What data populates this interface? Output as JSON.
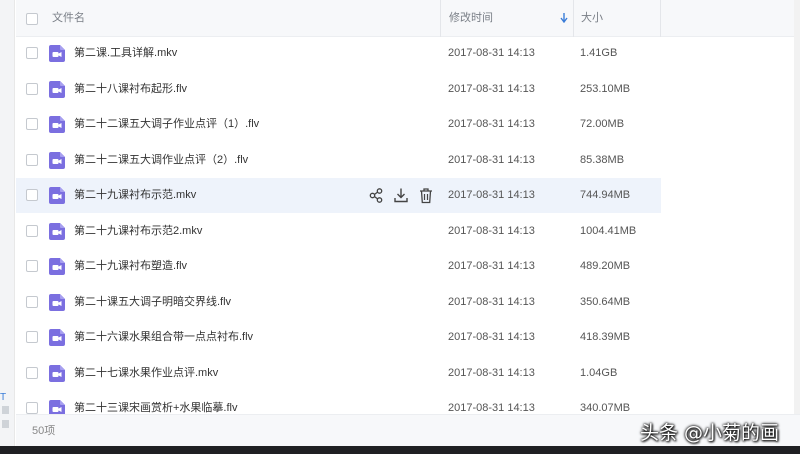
{
  "header": {
    "name_label": "文件名",
    "time_label": "修改时间",
    "size_label": "大小"
  },
  "files": [
    {
      "name": "第二课.工具详解.mkv",
      "modified": "2017-08-31 14:13",
      "size": "1.41GB"
    },
    {
      "name": "第二十八课衬布起形.flv",
      "modified": "2017-08-31 14:13",
      "size": "253.10MB"
    },
    {
      "name": "第二十二课五大调子作业点评（1）.flv",
      "modified": "2017-08-31 14:13",
      "size": "72.00MB"
    },
    {
      "name": "第二十二课五大调作业点评（2）.flv",
      "modified": "2017-08-31 14:13",
      "size": "85.38MB"
    },
    {
      "name": "第二十九课衬布示范.mkv",
      "modified": "2017-08-31 14:13",
      "size": "744.94MB"
    },
    {
      "name": "第二十九课衬布示范2.mkv",
      "modified": "2017-08-31 14:13",
      "size": "1004.41MB"
    },
    {
      "name": "第二十九课衬布塑造.flv",
      "modified": "2017-08-31 14:13",
      "size": "489.20MB"
    },
    {
      "name": "第二十课五大调子明暗交界线.flv",
      "modified": "2017-08-31 14:13",
      "size": "350.64MB"
    },
    {
      "name": "第二十六课水果组合带一点点衬布.flv",
      "modified": "2017-08-31 14:13",
      "size": "418.39MB"
    },
    {
      "name": "第二十七课水果作业点评.mkv",
      "modified": "2017-08-31 14:13",
      "size": "1.04GB"
    },
    {
      "name": "第二十三课宋画赏析+水果临摹.flv",
      "modified": "2017-08-31 14:13",
      "size": "340.07MB"
    }
  ],
  "footer": {
    "count": "50项"
  },
  "sidebar": {
    "t_letter": "T"
  },
  "watermark": "头条 @小菊的画",
  "icons": {
    "file_type": "video-file-icon",
    "share": "share-icon",
    "download": "download-icon",
    "delete": "trash-icon",
    "sort": "sort-desc-arrow-icon"
  },
  "colors": {
    "video_icon": "#7b6fe0",
    "accent": "#3b7dd8",
    "hover_row": "#eef3fb"
  },
  "hover_row_index": 4
}
